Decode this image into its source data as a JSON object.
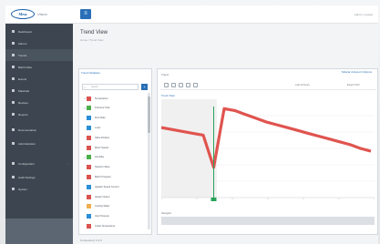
{
  "app": {
    "logo_text": "Mesa",
    "product_name": "Vision",
    "menu_icon": "hamburger-icon",
    "user": "Admin | Logout"
  },
  "sidebar": {
    "items": [
      {
        "label": "Dashboard"
      },
      {
        "label": "Alarms"
      },
      {
        "label": "Trends"
      },
      {
        "label": "Batch Data"
      },
      {
        "label": "Events"
      },
      {
        "label": "Materials"
      },
      {
        "label": "Recipes"
      },
      {
        "label": "Reports"
      },
      {
        "label": "Documentation"
      },
      {
        "label": "Administration"
      },
      {
        "label": "Configuration"
      },
      {
        "label": "Audit Settings"
      },
      {
        "label": "System"
      }
    ]
  },
  "page": {
    "title": "Trend View",
    "breadcrumb": "Home  /  Trend View"
  },
  "tag_panel": {
    "header": "Trend Variables",
    "search_placeholder": "Search",
    "add_label": "+",
    "tags": [
      {
        "label": "Temperature",
        "checked": true,
        "color": "#d9534f"
      },
      {
        "label": "Pressure Tank",
        "checked": true,
        "color": "#4cae4c"
      },
      {
        "label": "Flow Rate",
        "checked": false,
        "color": "#2a8fd6"
      },
      {
        "label": "Level",
        "checked": false,
        "color": "#2a8fd6"
      },
      {
        "label": "Valve Position",
        "checked": false,
        "color": "#d9534f"
      },
      {
        "label": "Motor Speed",
        "checked": false,
        "color": "#d9534f"
      },
      {
        "label": "Humidity",
        "checked": true,
        "color": "#4cae4c"
      },
      {
        "label": "Setpoint Value",
        "checked": false,
        "color": "#d9534f"
      },
      {
        "label": "Batch Progress",
        "checked": false,
        "color": "#d9534f"
      },
      {
        "label": "Agitator Speed Current",
        "checked": false,
        "color": "#2a8fd6"
      },
      {
        "label": "Heater Output",
        "checked": false,
        "color": "#d9534f"
      },
      {
        "label": "Cooling Water",
        "checked": false,
        "color": "#f0ad4e"
      },
      {
        "label": "Inlet Pressure",
        "checked": false,
        "color": "#2a8fd6"
      },
      {
        "label": "Outlet Temperature",
        "checked": false,
        "color": "#d9534f"
      }
    ]
  },
  "chart_panel": {
    "tab_label": "Trend",
    "link_text": "Tabular & Export Options",
    "plot_label": "Trend Chart",
    "range_label": "Navigator",
    "toolbar_labels": {
      "period": "Last 24 hours",
      "export": "Export CSV"
    }
  },
  "chart_data": {
    "type": "line",
    "series": [
      {
        "values": [
          0.72,
          0.7,
          0.68,
          0.66,
          0.64,
          0.3,
          0.92,
          0.9,
          0.86,
          0.82,
          0.78,
          0.75,
          0.72,
          0.69,
          0.66,
          0.63,
          0.6,
          0.57,
          0.54,
          0.5,
          0.47
        ]
      }
    ],
    "colors": {
      "line": "#e0544f",
      "marker": "#2aa35a",
      "shaded_region": "#f0f0f0"
    }
  },
  "status": {
    "text": "Connected | 1.0.0"
  }
}
